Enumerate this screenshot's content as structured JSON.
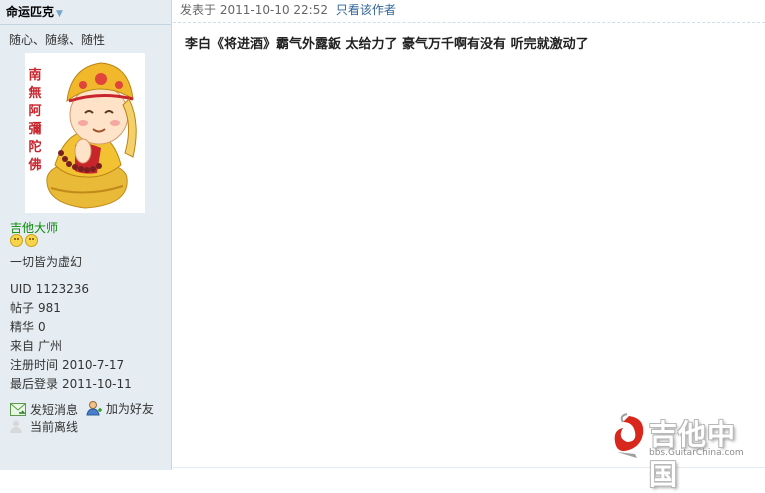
{
  "author": {
    "name": "命运匹克",
    "signature": "随心、随缘、随性"
  },
  "avatar": {
    "banner_text": "南無阿彌陀佛"
  },
  "profile": {
    "rank": "吉他大师",
    "stars": 2,
    "motto": "一切皆为虚幻",
    "stats": [
      {
        "key": "UID",
        "value": "1123236"
      },
      {
        "key": "帖子",
        "value": "981"
      },
      {
        "key": "精华",
        "value": "0"
      },
      {
        "key": "来自",
        "value": "广州"
      },
      {
        "key": "注册时间",
        "value": "2010-7-17"
      },
      {
        "key": "最后登录",
        "value": "2011-10-11"
      }
    ],
    "actions": {
      "message": "发短消息",
      "add_friend": "加为好友"
    },
    "status": "当前离线"
  },
  "post": {
    "meta_prefix": "发表于",
    "timestamp": "2011-10-10 22:52",
    "only_author": "只看该作者",
    "content": "李白《将进酒》霸气外露鈑 太给力了 豪气万千啊有没有 听完就激动了"
  },
  "watermark": {
    "title": "吉他中国",
    "url": "bbs.GuitarChina.com"
  }
}
